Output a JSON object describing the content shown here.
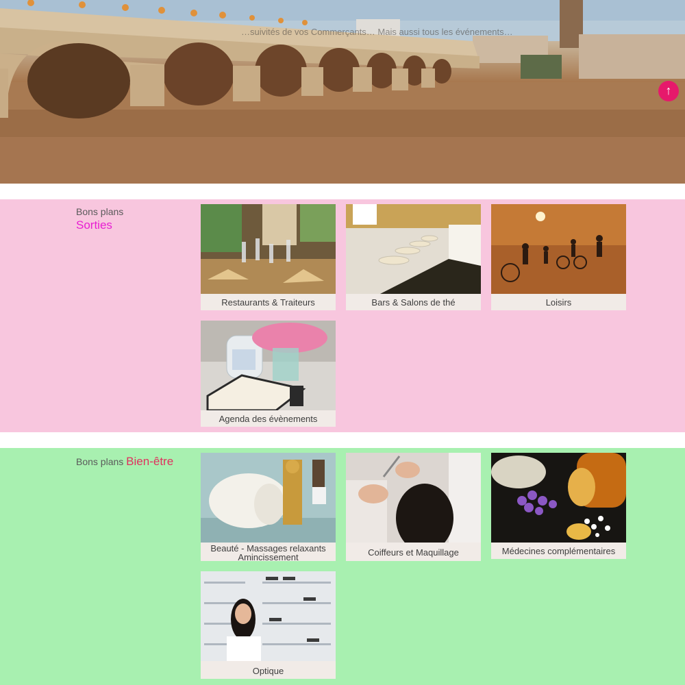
{
  "hero": {
    "text": "…suivités de vos Commerçants… Mais aussi tous les événements…",
    "scroll_top": "↑"
  },
  "sections": [
    {
      "prefix": "Bons plans",
      "title": "Sorties",
      "title_color": "#e81ed2",
      "background": "#f8c6de",
      "tiles": [
        {
          "label": "Restaurants & Traiteurs"
        },
        {
          "label": "Bars & Salons de thé"
        },
        {
          "label": "Loisirs"
        },
        {
          "label": "Agenda des évènements"
        }
      ]
    },
    {
      "prefix": "Bons plans",
      "title": "Bien-être",
      "title_color": "#e0305e",
      "background": "#a8f0b0",
      "tiles": [
        {
          "label": "Beauté - Massages relaxants Amincissement"
        },
        {
          "label": "Coiffeurs et Maquillage"
        },
        {
          "label": "Médecines complémentaires"
        },
        {
          "label": "Optique"
        }
      ]
    }
  ]
}
